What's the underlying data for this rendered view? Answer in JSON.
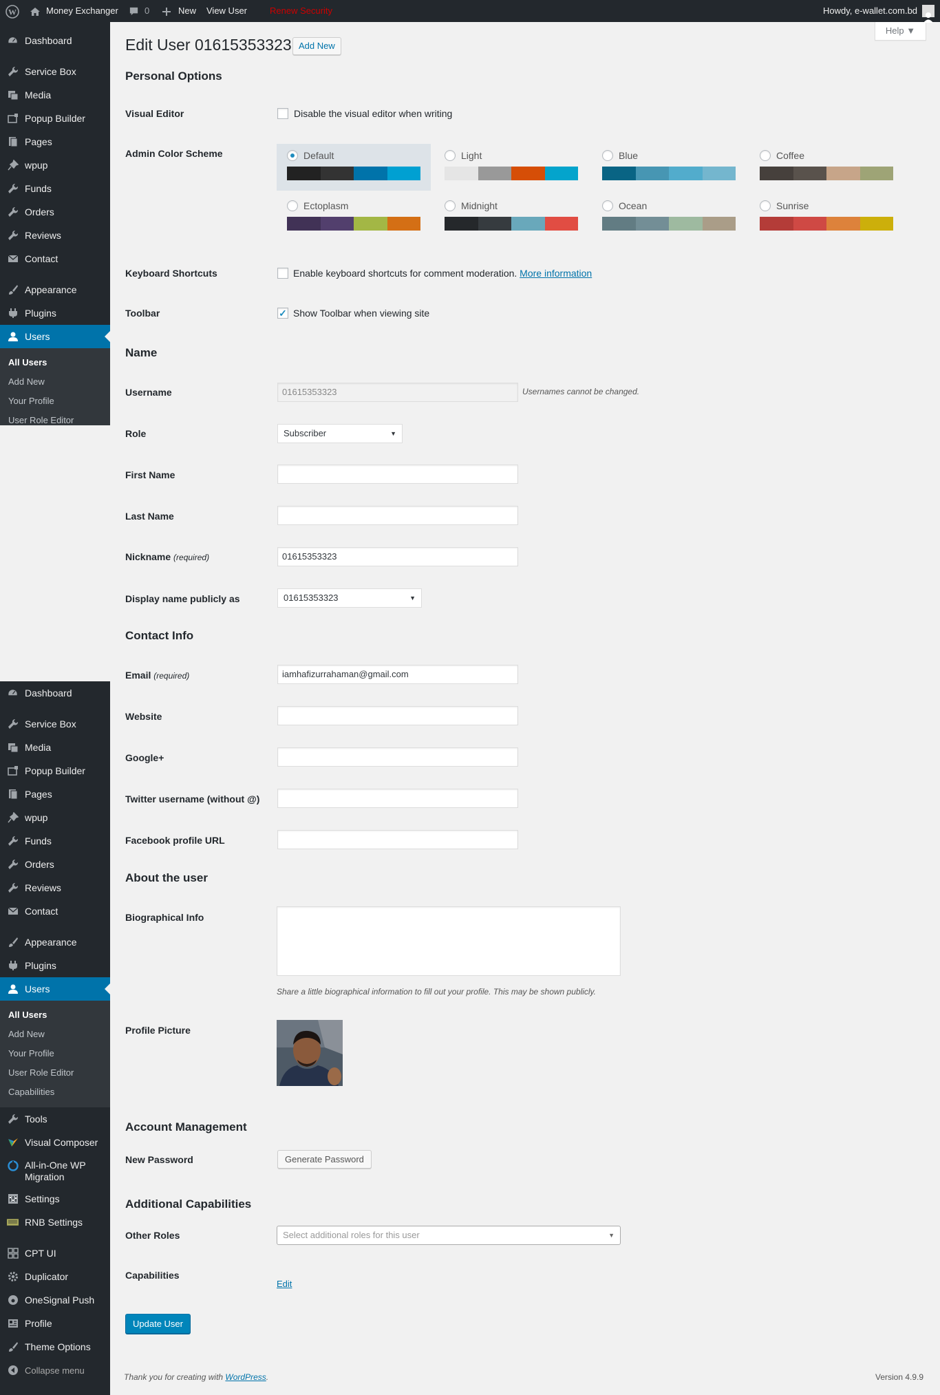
{
  "adminbar": {
    "site_name": "Money Exchanger",
    "comments_count": "0",
    "new_label": "New",
    "view_user_label": "View User",
    "renew_security_label": "Renew Security",
    "howdy": "Howdy, e-wallet.com.bd"
  },
  "help_label": "Help",
  "sidebar_top": {
    "items": [
      {
        "label": "Dashboard",
        "icon": "dashboard-icon"
      },
      {
        "label": "Service Box",
        "icon": "wrench-icon"
      },
      {
        "label": "Media",
        "icon": "media-icon"
      },
      {
        "label": "Popup Builder",
        "icon": "popup-icon"
      },
      {
        "label": "Pages",
        "icon": "pages-icon"
      },
      {
        "label": "wpup",
        "icon": "pin-icon"
      },
      {
        "label": "Funds",
        "icon": "wrench-icon"
      },
      {
        "label": "Orders",
        "icon": "wrench-icon"
      },
      {
        "label": "Reviews",
        "icon": "wrench-icon"
      },
      {
        "label": "Contact",
        "icon": "mail-icon"
      },
      {
        "label": "Appearance",
        "icon": "brush-icon"
      },
      {
        "label": "Plugins",
        "icon": "plugin-icon"
      },
      {
        "label": "Users",
        "icon": "user-icon"
      }
    ],
    "submenu": [
      "All Users",
      "Add New",
      "Your Profile",
      "User Role Editor"
    ]
  },
  "sidebar_bottom": {
    "items": [
      {
        "label": "Dashboard"
      },
      {
        "label": "Service Box"
      },
      {
        "label": "Media"
      },
      {
        "label": "Popup Builder"
      },
      {
        "label": "Pages"
      },
      {
        "label": "wpup"
      },
      {
        "label": "Funds"
      },
      {
        "label": "Orders"
      },
      {
        "label": "Reviews"
      },
      {
        "label": "Contact"
      },
      {
        "label": "Appearance"
      },
      {
        "label": "Plugins"
      },
      {
        "label": "Users"
      }
    ],
    "submenu": [
      "All Users",
      "Add New",
      "Your Profile",
      "User Role Editor",
      "Capabilities"
    ],
    "after": [
      {
        "label": "Tools"
      },
      {
        "label": "Visual Composer"
      },
      {
        "label": "All-in-One WP Migration"
      },
      {
        "label": "Settings"
      },
      {
        "label": "RNB Settings"
      },
      {
        "label": "CPT UI"
      },
      {
        "label": "Duplicator"
      },
      {
        "label": "OneSignal Push"
      },
      {
        "label": "Profile"
      },
      {
        "label": "Theme Options"
      },
      {
        "label": "Collapse menu"
      }
    ]
  },
  "page": {
    "title": "Edit User 01615353323",
    "add_new": "Add New",
    "personal_options": "Personal Options",
    "visual_editor_label": "Visual Editor",
    "visual_editor_text": "Disable the visual editor when writing",
    "color_scheme_label": "Admin Color Scheme",
    "schemes": [
      {
        "name": "Default",
        "colors": [
          "#222222",
          "#333333",
          "#0073aa",
          "#00a0d2"
        ]
      },
      {
        "name": "Light",
        "colors": [
          "#e5e5e5",
          "#999999",
          "#d64e07",
          "#04a4cc"
        ]
      },
      {
        "name": "Blue",
        "colors": [
          "#096484",
          "#4796b3",
          "#52accc",
          "#74B6CE"
        ]
      },
      {
        "name": "Coffee",
        "colors": [
          "#46403c",
          "#59524c",
          "#c7a589",
          "#9ea476"
        ]
      },
      {
        "name": "Ectoplasm",
        "colors": [
          "#413256",
          "#523f6d",
          "#a3b745",
          "#d46f15"
        ]
      },
      {
        "name": "Midnight",
        "colors": [
          "#25282b",
          "#363b3f",
          "#69a8bb",
          "#e14d43"
        ]
      },
      {
        "name": "Ocean",
        "colors": [
          "#627c83",
          "#738e96",
          "#9ebaa0",
          "#aa9d88"
        ]
      },
      {
        "name": "Sunrise",
        "colors": [
          "#b43c38",
          "#cf4944",
          "#dd823b",
          "#ccaf0b"
        ]
      }
    ],
    "keyboard_label": "Keyboard Shortcuts",
    "keyboard_text": "Enable keyboard shortcuts for comment moderation.",
    "keyboard_link": "More information",
    "toolbar_label": "Toolbar",
    "toolbar_text": "Show Toolbar when viewing site",
    "name_heading": "Name",
    "username_label": "Username",
    "username_value": "01615353323",
    "username_note": "Usernames cannot be changed.",
    "role_label": "Role",
    "role_value": "Subscriber",
    "first_name_label": "First Name",
    "last_name_label": "Last Name",
    "nickname_label": "Nickname",
    "nickname_required": "(required)",
    "nickname_value": "01615353323",
    "display_name_label": "Display name publicly as",
    "display_name_value": "01615353323",
    "contact_heading": "Contact Info",
    "email_label": "Email",
    "email_required": "(required)",
    "email_value": "iamhafizurrahaman@gmail.com",
    "website_label": "Website",
    "google_label": "Google+",
    "twitter_label": "Twitter username (without @)",
    "facebook_label": "Facebook profile URL",
    "about_heading": "About the user",
    "bio_label": "Biographical Info",
    "bio_desc": "Share a little biographical information to fill out your profile. This may be shown publicly.",
    "profile_picture_label": "Profile Picture",
    "account_heading": "Account Management",
    "new_password_label": "New Password",
    "generate_password": "Generate Password",
    "additional_heading": "Additional Capabilities",
    "other_roles_label": "Other Roles",
    "other_roles_placeholder": "Select additional roles for this user",
    "capabilities_label": "Capabilities",
    "capabilities_edit": "Edit",
    "update_button": "Update User"
  },
  "footer": {
    "thanks": "Thank you for creating with",
    "wordpress": "WordPress",
    "version": "Version 4.9.9"
  }
}
